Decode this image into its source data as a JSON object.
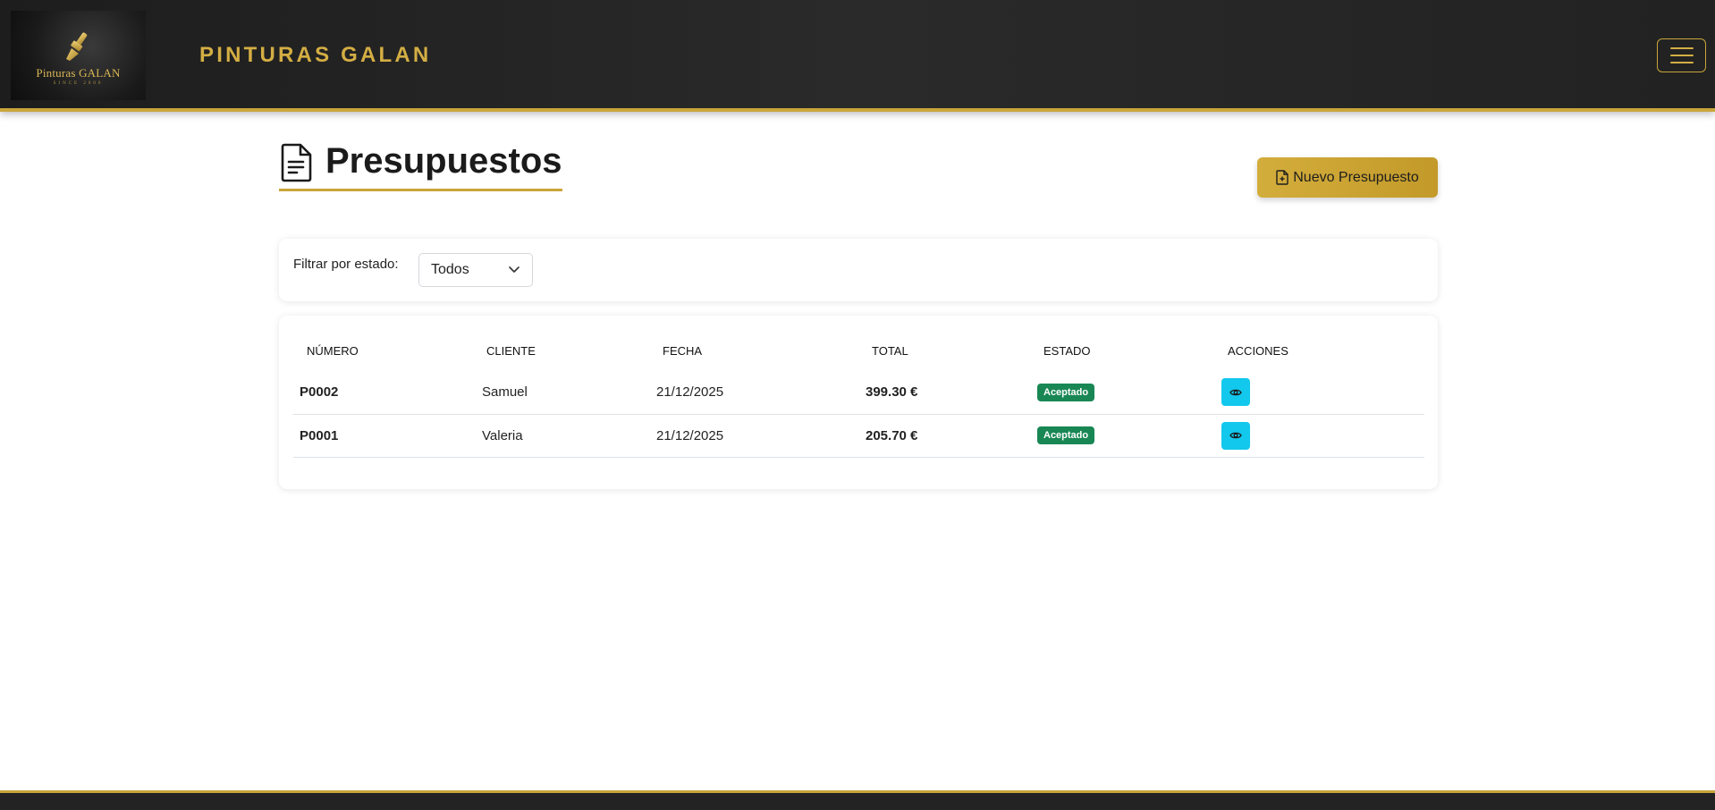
{
  "header": {
    "logo_text": "Pinturas GALAN",
    "logo_subtext": "SINCE 2000",
    "brand": "PINTURAS GALAN",
    "menu_icon": "hamburger-menu-icon"
  },
  "page": {
    "title": "Presupuestos",
    "title_icon": "document-icon",
    "new_button_label": "Nuevo Presupuesto",
    "new_button_icon": "file-plus-icon"
  },
  "filter": {
    "label": "Filtrar por estado:",
    "selected": "Todos"
  },
  "table": {
    "columns": [
      "NÚMERO",
      "CLIENTE",
      "FECHA",
      "TOTAL",
      "ESTADO",
      "ACCIONES"
    ],
    "rows": [
      {
        "numero": "P0002",
        "cliente": "Samuel",
        "fecha": "21/12/2025",
        "total": "399.30 €",
        "estado": "Aceptado",
        "action_icon": "eye-icon"
      },
      {
        "numero": "P0001",
        "cliente": "Valeria",
        "fecha": "21/12/2025",
        "total": "205.70 €",
        "estado": "Aceptado",
        "action_icon": "eye-icon"
      }
    ]
  },
  "colors": {
    "accent_gold": "#c9a53a",
    "header_bg": "#222222",
    "success_badge": "#198754",
    "info_button": "#12c8ec"
  }
}
